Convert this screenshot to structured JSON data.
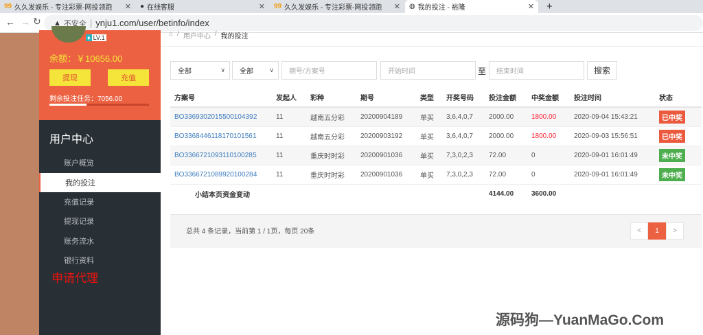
{
  "browser": {
    "tabs": [
      {
        "title": "久久发娱乐 - 专注彩票-网投领跑"
      },
      {
        "title": "在线客服"
      },
      {
        "title": "久久发娱乐 - 专注彩票-网投领跑"
      },
      {
        "title": "我的投注 - 裕隆"
      }
    ],
    "insecure": "不安全",
    "url": "ynju1.com/user/betinfo/index"
  },
  "user": {
    "level": "LV.1",
    "balance": "余额：￥10656.00",
    "withdraw": "提现",
    "recharge": "充值",
    "task": "剩余投注任务：7056.00",
    "task_progress": 0.37
  },
  "sidebar": {
    "title": "用户中心",
    "items": [
      "账户概览",
      "我的投注",
      "充值记录",
      "提现记录",
      "账务流水",
      "银行资料"
    ],
    "agent": "申请代理"
  },
  "breadcrumb": [
    "用户中心",
    "我的投注"
  ],
  "filters": {
    "select1": "全部",
    "select2": "全部",
    "issue_placeholder": "期号/方案号",
    "start_placeholder": "开始时间",
    "to": "至",
    "end_placeholder": "结束时间",
    "search": "搜索"
  },
  "table": {
    "headers": [
      "方案号",
      "发起人",
      "彩种",
      "期号",
      "类型",
      "开奖号码",
      "投注金额",
      "中奖金额",
      "投注时间",
      "状态"
    ],
    "rows": [
      [
        "BO336930201550010439 2",
        "11",
        "越南五分彩",
        "20200904189",
        "单买",
        "3,6,4,0,7",
        "2000.00",
        "1800.00",
        "2020-09-04 15:43:21",
        "已中奖"
      ],
      [
        "BO336844611817010156 1",
        "11",
        "越南五分彩",
        "20200903192",
        "单买",
        "3,6,4,0,7",
        "2000.00",
        "1800.00",
        "2020-09-03 15:56:51",
        "已中奖"
      ],
      [
        "BO336672109311010028 5",
        "11",
        "重庆时时彩",
        "20200901036",
        "单买",
        "7,3,0,2,3",
        "72.00",
        "0",
        "2020-09-01 16:01:49",
        "未中奖"
      ],
      [
        "BO336672108992010028 4",
        "11",
        "重庆时时彩",
        "20200901036",
        "单买",
        "7,3,0,2,3",
        "72.00",
        "0",
        "2020-09-01 16:01:49",
        "未中奖"
      ]
    ],
    "summary": {
      "label": "小结本页资金变动",
      "bet": "4144.00",
      "win": "3600.00"
    }
  },
  "pager": {
    "info": "总共 4 条记录，当前第 1 / 1页，每页 20条",
    "prev": "<",
    "page": "1",
    "next": ">"
  },
  "watermark": "源码狗—YuanMaGo.Com",
  "colors": {
    "accent": "#ec6141",
    "sidebar": "#282f35",
    "win": "#ec5a3e",
    "lose": "#4cae4c"
  }
}
